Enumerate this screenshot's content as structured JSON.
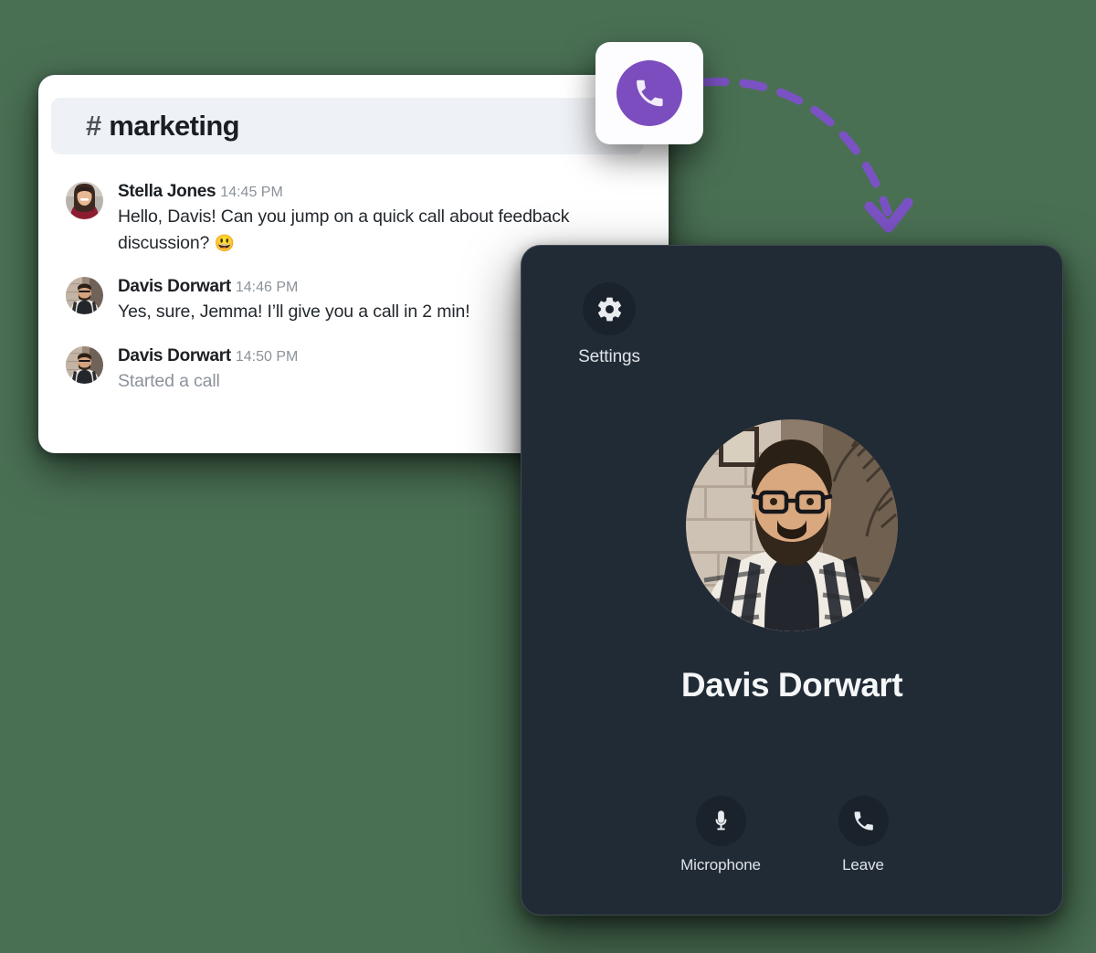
{
  "chat": {
    "header": {
      "hash": "#",
      "channel": "marketing"
    },
    "messages": [
      {
        "author": "Stella Jones",
        "time": "14:45 PM",
        "text": "Hello, Davis! Can you jump on a quick call about feedback discussion? ",
        "emoji": "😃",
        "muted": false,
        "avatar": "stella-jones-avatar"
      },
      {
        "author": "Davis Dorwart",
        "time": "14:46 PM",
        "text": "Yes, sure, Jemma! I’ll give you a call in 2 min!",
        "emoji": "",
        "muted": false,
        "avatar": "davis-dorwart-avatar"
      },
      {
        "author": "Davis Dorwart",
        "time": "14:50 PM",
        "text": "Started a call",
        "emoji": "",
        "muted": true,
        "avatar": "davis-dorwart-avatar"
      }
    ]
  },
  "call_launcher": {
    "icon": "phone-icon",
    "accent_color": "#7c4dbe",
    "tile_color": "#fdfdff"
  },
  "arrow": {
    "name": "dashed-curved-arrow",
    "color": "#7b52c4",
    "style": "dashed"
  },
  "call_panel": {
    "background_color": "#212b36",
    "settings": {
      "label": "Settings",
      "icon": "gear-icon"
    },
    "callee": {
      "name": "Davis Dorwart",
      "photo": "davis-dorwart-photo"
    },
    "controls": [
      {
        "label": "Microphone",
        "icon": "microphone-icon"
      },
      {
        "label": "Leave",
        "icon": "phone-icon"
      }
    ]
  },
  "page": {
    "background_color": "#4a7054"
  }
}
